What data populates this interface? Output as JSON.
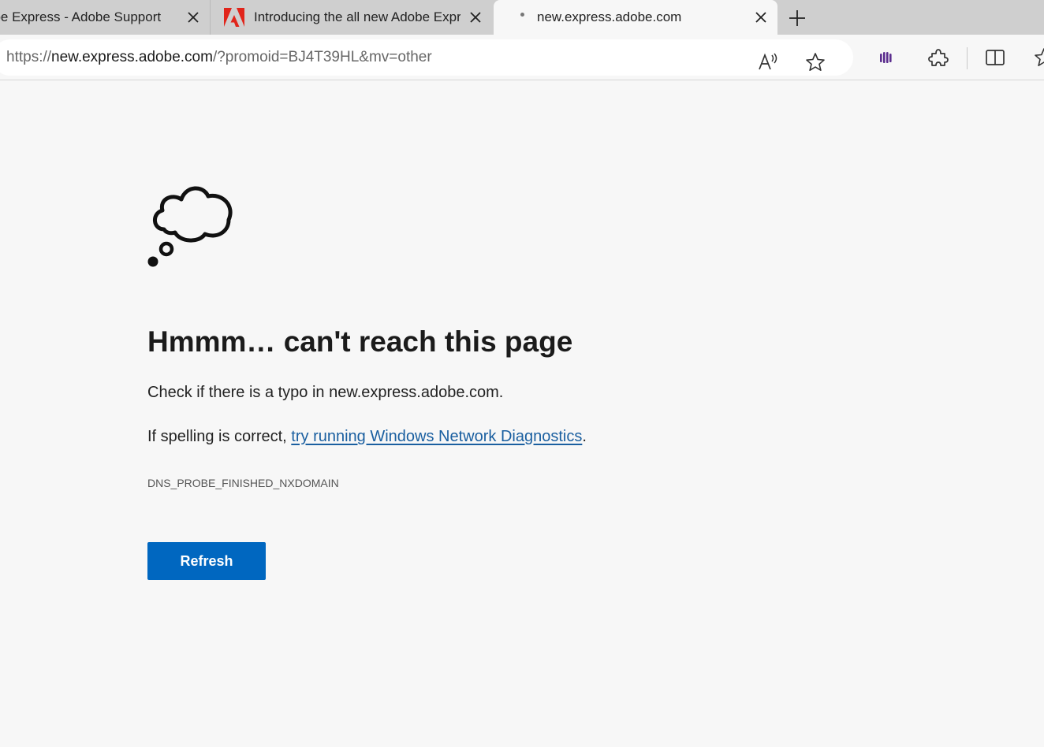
{
  "tabs": [
    {
      "title": "obe Express - Adobe Support",
      "favicon": "none",
      "close_icon": "close-icon"
    },
    {
      "title": "Introducing the all new Adobe Express",
      "favicon": "adobe-logo-icon",
      "close_icon": "close-icon"
    },
    {
      "title": "new.express.adobe.com",
      "favicon": "loading-dot-icon",
      "close_icon": "close-icon",
      "active": true
    }
  ],
  "address_bar": {
    "scheme": "https://",
    "host": "new.express.adobe.com",
    "path": "/?promoid=BJ4T39HL&mv=other"
  },
  "toolbar_icons": [
    "read-aloud-icon",
    "favorite-star-icon",
    "extension-purple-icon",
    "extensions-puzzle-icon",
    "split-screen-icon",
    "favorites-icon"
  ],
  "error_page": {
    "heading": "Hmmm… can't reach this page",
    "typo_text": "Check if there is a typo in new.express.adobe.com.",
    "spelling_prefix": "If spelling is correct, ",
    "diagnostics_link": "try running Windows Network Diagnostics",
    "spelling_suffix": ".",
    "error_code": "DNS_PROBE_FINISHED_NXDOMAIN",
    "refresh_label": "Refresh"
  },
  "colors": {
    "accent": "#0067c0",
    "link": "#1a5fa0",
    "page_bg": "#f7f7f7",
    "tabstrip_bg": "#cfcfcf",
    "adobe_red": "#e1251b",
    "extension_purple": "#5b2d8e"
  }
}
